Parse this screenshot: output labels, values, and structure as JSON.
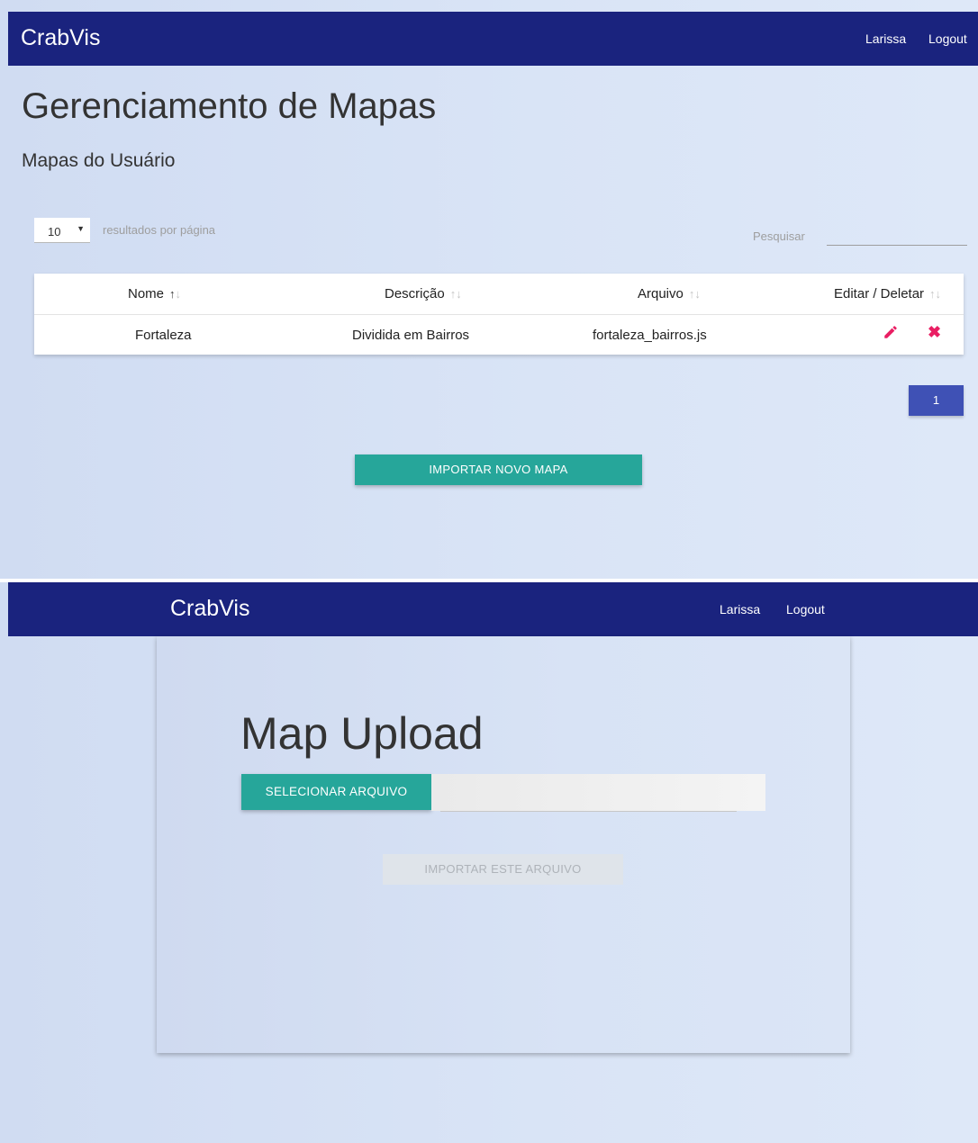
{
  "screen1": {
    "navbar": {
      "brand": "CrabVis",
      "user": "Larissa",
      "logout": "Logout"
    },
    "page_title": "Gerenciamento de Mapas",
    "section_title": "Mapas do Usuário",
    "length": {
      "value": "10",
      "label": "resultados por página"
    },
    "search": {
      "label": "Pesquisar",
      "value": ""
    },
    "table": {
      "headers": [
        "Nome",
        "Descrição",
        "Arquivo",
        "Editar / Deletar"
      ],
      "rows": [
        {
          "nome": "Fortaleza",
          "descricao": "Dividida em Bairros",
          "arquivo": "fortaleza_bairros.js"
        }
      ]
    },
    "pagination": {
      "current_page": "1"
    },
    "import_button": "IMPORTAR NOVO MAPA",
    "colors": {
      "navbar": "#1a237e",
      "primary": "#26a69a",
      "pagination": "#3f51b5",
      "danger": "#e91e63"
    }
  },
  "screen2": {
    "navbar": {
      "brand": "CrabVis",
      "user": "Larissa",
      "logout": "Logout"
    },
    "title": "Map Upload",
    "select_file_button": "SELECIONAR ARQUIVO",
    "file_path": "",
    "import_file_button": "IMPORTAR ESTE ARQUIVO"
  }
}
